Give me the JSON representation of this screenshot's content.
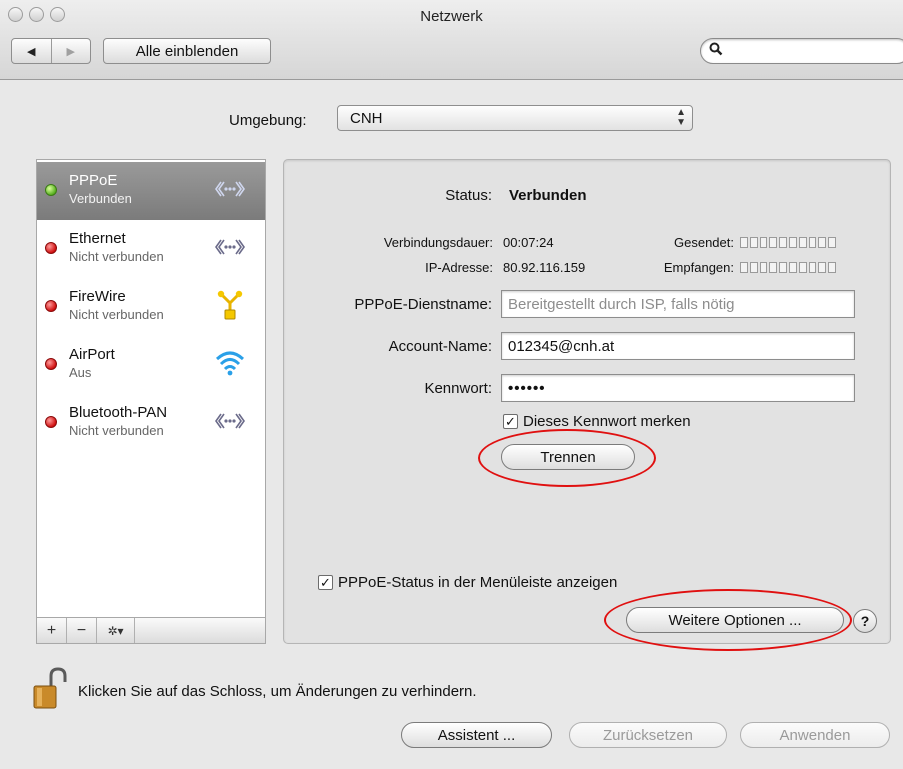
{
  "window": {
    "title": "Netzwerk"
  },
  "toolbar": {
    "back_icon": "◀",
    "forward_icon": "▶",
    "show_all_label": "Alle einblenden",
    "search_icon": "magnifier-icon",
    "search_placeholder": ""
  },
  "location": {
    "label": "Umgebung:",
    "value": "CNH"
  },
  "services": [
    {
      "name": "PPPoE",
      "status": "Verbunden",
      "dot": "green",
      "icon": "«◦◦◦»",
      "selected": true
    },
    {
      "name": "Ethernet",
      "status": "Nicht verbunden",
      "dot": "red",
      "icon": "«◦◦◦»",
      "selected": false
    },
    {
      "name": "FireWire",
      "status": "Nicht verbunden",
      "dot": "red",
      "icon": "firewire",
      "selected": false
    },
    {
      "name": "AirPort",
      "status": "Aus",
      "dot": "red",
      "icon": "wifi",
      "selected": false
    },
    {
      "name": "Bluetooth-PAN",
      "status": "Nicht verbunden",
      "dot": "red",
      "icon": "«◦◦◦»",
      "selected": false
    }
  ],
  "list_controls": {
    "add": "+",
    "remove": "−",
    "gear": "✲▾"
  },
  "detail": {
    "status_label": "Status:",
    "status_value": "Verbunden",
    "duration_label": "Verbindungsdauer:",
    "duration_value": "00:07:24",
    "ip_label": "IP-Adresse:",
    "ip_value": "80.92.116.159",
    "sent_label": "Gesendet:",
    "received_label": "Empfangen:",
    "service_name_label": "PPPoE-Dienstname:",
    "service_name_placeholder": "Bereitgestellt durch ISP, falls nötig",
    "account_label": "Account-Name:",
    "account_value": "012345@cnh.at",
    "password_label": "Kennwort:",
    "password_value": "••••••",
    "remember_label": "Dieses Kennwort merken",
    "remember_checked": true,
    "disconnect_label": "Trennen",
    "menubar_label": "PPPoE-Status in der Menüleiste anzeigen",
    "menubar_checked": true,
    "more_options_label": "Weitere Optionen ...",
    "help_label": "?"
  },
  "footer": {
    "lock_text": "Klicken Sie auf das Schloss, um Änderungen zu verhindern.",
    "assistant_label": "Assistent ...",
    "revert_label": "Zurücksetzen",
    "apply_label": "Anwenden"
  },
  "colors": {
    "annotation_ring": "#e01010",
    "status_green": "#58b020",
    "status_red": "#d01010"
  }
}
